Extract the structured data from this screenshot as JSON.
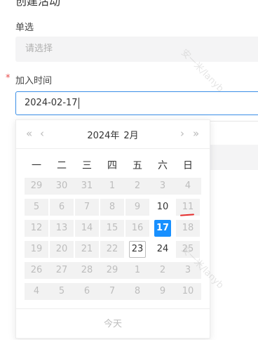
{
  "form": {
    "top_label_partial": "创建活动",
    "single_select": {
      "label": "单选",
      "placeholder": "请选择"
    },
    "join_time": {
      "required_mark": "*",
      "label": "加入时间",
      "value": "2024-02-17"
    }
  },
  "calendar": {
    "nav": {
      "prev_year": "«",
      "prev_month": "‹",
      "next_month": "›",
      "next_year": "»"
    },
    "header": {
      "year": "2024年",
      "month": "2月"
    },
    "weekdays": [
      "一",
      "二",
      "三",
      "四",
      "五",
      "六",
      "日"
    ],
    "weeks": [
      [
        {
          "d": "29",
          "s": "disabled"
        },
        {
          "d": "30",
          "s": "disabled"
        },
        {
          "d": "31",
          "s": "disabled"
        },
        {
          "d": "1",
          "s": "disabled"
        },
        {
          "d": "2",
          "s": "disabled"
        },
        {
          "d": "3",
          "s": "disabled"
        },
        {
          "d": "4",
          "s": "disabled"
        }
      ],
      [
        {
          "d": "5",
          "s": "disabled"
        },
        {
          "d": "6",
          "s": "disabled"
        },
        {
          "d": "7",
          "s": "disabled"
        },
        {
          "d": "8",
          "s": "disabled"
        },
        {
          "d": "9",
          "s": "disabled"
        },
        {
          "d": "10",
          "s": "enabled"
        },
        {
          "d": "11",
          "s": "disabled"
        }
      ],
      [
        {
          "d": "12",
          "s": "disabled"
        },
        {
          "d": "13",
          "s": "disabled"
        },
        {
          "d": "14",
          "s": "disabled"
        },
        {
          "d": "15",
          "s": "disabled"
        },
        {
          "d": "16",
          "s": "disabled"
        },
        {
          "d": "17",
          "s": "selected"
        },
        {
          "d": "18",
          "s": "disabled"
        }
      ],
      [
        {
          "d": "19",
          "s": "disabled"
        },
        {
          "d": "20",
          "s": "disabled"
        },
        {
          "d": "21",
          "s": "disabled"
        },
        {
          "d": "22",
          "s": "disabled"
        },
        {
          "d": "23",
          "s": "today"
        },
        {
          "d": "24",
          "s": "enabled"
        },
        {
          "d": "25",
          "s": "disabled"
        }
      ],
      [
        {
          "d": "26",
          "s": "disabled"
        },
        {
          "d": "27",
          "s": "disabled"
        },
        {
          "d": "28",
          "s": "disabled"
        },
        {
          "d": "29",
          "s": "disabled"
        },
        {
          "d": "1",
          "s": "disabled"
        },
        {
          "d": "2",
          "s": "disabled"
        },
        {
          "d": "3",
          "s": "disabled"
        }
      ],
      [
        {
          "d": "4",
          "s": "disabled"
        },
        {
          "d": "5",
          "s": "disabled"
        },
        {
          "d": "6",
          "s": "disabled"
        },
        {
          "d": "7",
          "s": "disabled"
        },
        {
          "d": "8",
          "s": "disabled"
        },
        {
          "d": "9",
          "s": "disabled"
        },
        {
          "d": "10",
          "s": "disabled"
        }
      ]
    ],
    "today_button": "今天"
  },
  "watermark": [
    "安一米/lanyb",
    "安一米/lanyb"
  ],
  "colors": {
    "primary": "#1890ff",
    "required": "#e84b4b",
    "annotation": "#e52d2d"
  }
}
